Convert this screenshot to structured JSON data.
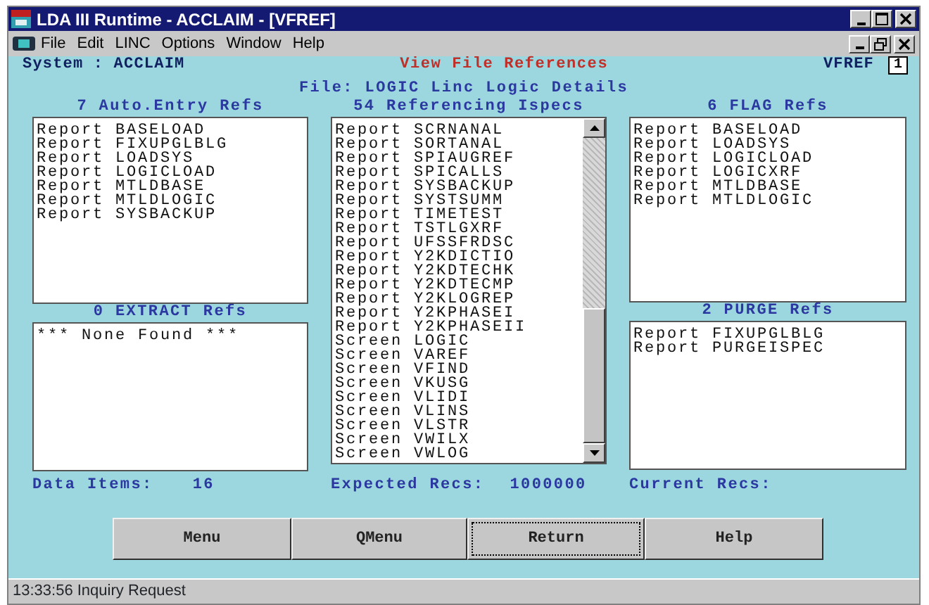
{
  "window": {
    "title": "LDA III Runtime - ACCLAIM - [VFREF]"
  },
  "menu": [
    "File",
    "Edit",
    "LINC",
    "Options",
    "Window",
    "Help"
  ],
  "header": {
    "system": "System : ACCLAIM",
    "screen_title": "View File References",
    "screen_code": "VFREF",
    "page": "1",
    "file": "File: LOGIC Linc Logic Details"
  },
  "columns": [
    {
      "panels": [
        {
          "title": "7 Auto.Entry Refs",
          "scrollable": false,
          "items": [
            "Report BASELOAD",
            "Report FIXUPGLBLG",
            "Report LOADSYS",
            "Report LOGICLOAD",
            "Report MTLDBASE",
            "Report MTLDLOGIC",
            "Report SYSBACKUP"
          ]
        },
        {
          "title": "0 EXTRACT Refs",
          "scrollable": false,
          "items": [
            "*** None Found ***"
          ]
        }
      ]
    },
    {
      "panels": [
        {
          "title": "54 Referencing Ispecs",
          "scrollable": true,
          "items": [
            "Report SCRNANAL",
            "Report SORTANAL",
            "Report SPIAUGREF",
            "Report SPICALLS",
            "Report SYSBACKUP",
            "Report SYSTSUMM",
            "Report TIMETEST",
            "Report TSTLGXRF",
            "Report UFSSFRDSC",
            "Report Y2KDICTIO",
            "Report Y2KDTECHK",
            "Report Y2KDTECMP",
            "Report Y2KLOGREP",
            "Report Y2KPHASEI",
            "Report Y2KPHASEII",
            "Screen LOGIC",
            "Screen VAREF",
            "Screen VFIND",
            "Screen VKUSG",
            "Screen VLIDI",
            "Screen VLINS",
            "Screen VLSTR",
            "Screen VWILX",
            "Screen VWLOG"
          ]
        }
      ]
    },
    {
      "panels": [
        {
          "title": "6 FLAG Refs",
          "scrollable": false,
          "items": [
            "Report BASELOAD",
            "Report LOADSYS",
            "Report LOGICLOAD",
            "Report LOGICXRF",
            "Report MTLDBASE",
            "Report MTLDLOGIC"
          ]
        },
        {
          "title": "2 PURGE Refs",
          "scrollable": false,
          "items": [
            "Report FIXUPGLBLG",
            "Report PURGEISPEC"
          ]
        }
      ]
    }
  ],
  "footer": [
    {
      "label": "Data Items:",
      "value": "16"
    },
    {
      "label": "Expected Recs:",
      "value": "1000000"
    },
    {
      "label": "Current Recs:"
    }
  ],
  "buttons": [
    {
      "label": "Menu",
      "focused": false
    },
    {
      "label": "QMenu",
      "focused": false
    },
    {
      "label": "Return",
      "focused": true
    },
    {
      "label": "Help",
      "focused": false
    }
  ],
  "status_bar": "13:33:56 Inquiry Request"
}
